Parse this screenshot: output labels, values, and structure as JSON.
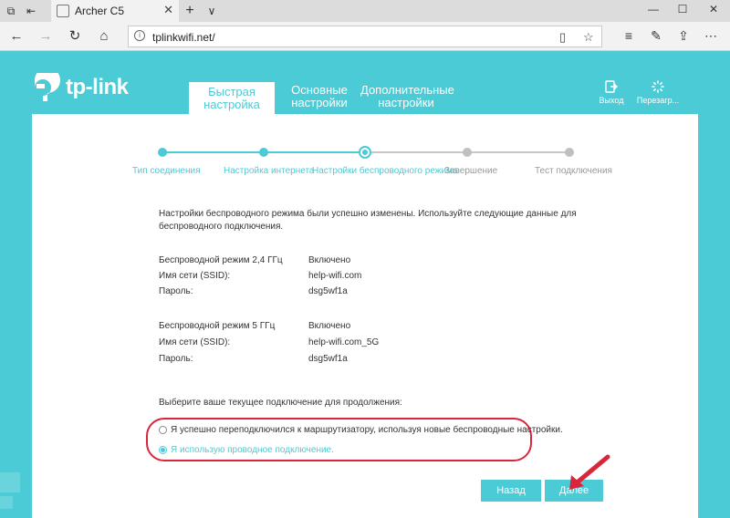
{
  "browser": {
    "tab_title": "Archer C5",
    "url": "tplinkwifi.net/",
    "new_tab": "+",
    "tab_menu": "∨",
    "close": "✕",
    "minimize": "—",
    "restore": "☐",
    "window_close": "✕"
  },
  "header": {
    "logo": "tp-link",
    "tabs": [
      {
        "label": "Быстрая настройка"
      },
      {
        "label": "Основные настройки"
      },
      {
        "label": "Дополнительные настройки"
      }
    ],
    "logout": "Выход",
    "reboot": "Перезагр..."
  },
  "steps": [
    {
      "label": "Тип соединения",
      "state": "done"
    },
    {
      "label": "Настройка интернета",
      "state": "done"
    },
    {
      "label": "Настройки беспроводного режима",
      "state": "current"
    },
    {
      "label": "Завершение",
      "state": "pending"
    },
    {
      "label": "Тест подключения",
      "state": "pending"
    }
  ],
  "main": {
    "intro": "Настройки беспроводного режима были успешно изменены. Используйте следующие данные для беспроводного подключения.",
    "band24": {
      "label": "Беспроводной режим 2,4 ГГц",
      "value": "Включено",
      "ssid_label": "Имя сети (SSID):",
      "ssid": "help-wifi.com",
      "pass_label": "Пароль:",
      "pass": "dsg5wf1a"
    },
    "band5": {
      "label": "Беспроводной режим 5 ГГц",
      "value": "Включено",
      "ssid_label": "Имя сети (SSID):",
      "ssid": "help-wifi.com_5G",
      "pass_label": "Пароль:",
      "pass": "dsg5wf1a"
    },
    "prompt": "Выберите ваше текущее подключение для продолжения:",
    "options": [
      {
        "label": "Я успешно переподключился к маршрутизатору, используя новые беспроводные настройки.",
        "checked": false
      },
      {
        "label": "Я использую проводное подключение.",
        "checked": true
      }
    ],
    "back_label": "Назад",
    "next_label": "Далее"
  },
  "colors": {
    "accent": "#4acbd6",
    "highlight": "#d9263a"
  }
}
